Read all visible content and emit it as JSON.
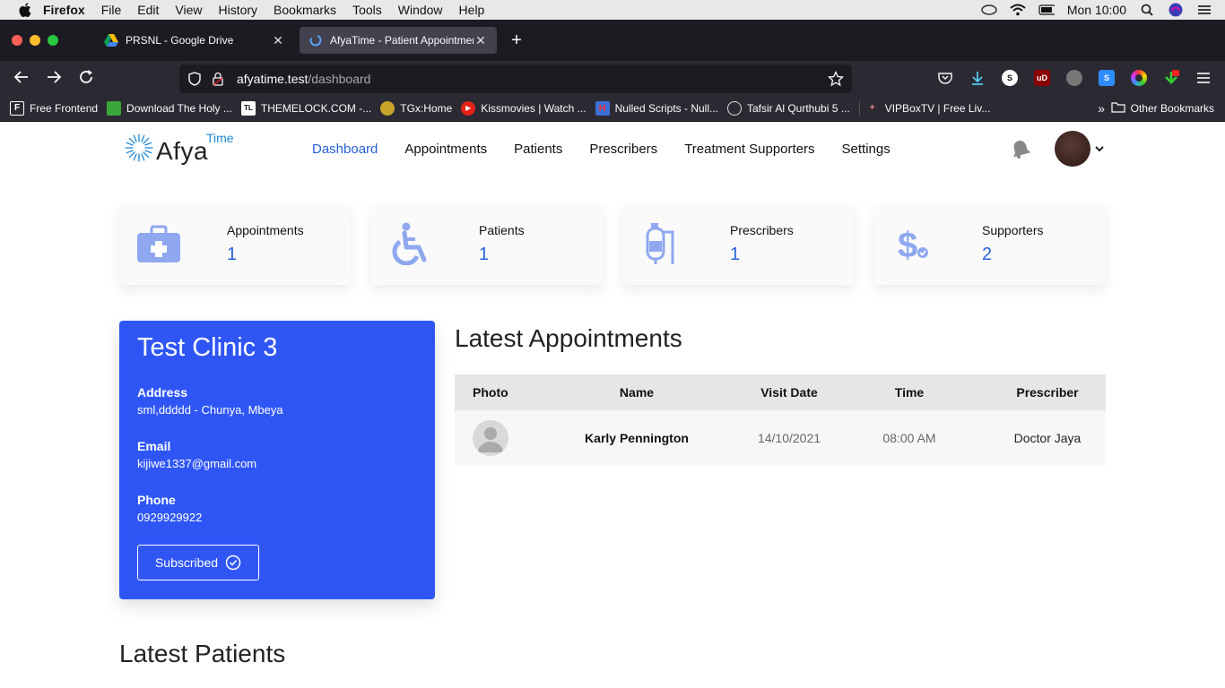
{
  "menubar": {
    "app_name": "Firefox",
    "items": [
      "File",
      "Edit",
      "View",
      "History",
      "Bookmarks",
      "Tools",
      "Window",
      "Help"
    ],
    "clock": "Mon 10:00"
  },
  "browser": {
    "tabs": [
      {
        "title": "PRSNL - Google Drive",
        "active": false
      },
      {
        "title": "AfyaTime - Patient Appointment",
        "active": true
      }
    ],
    "url_host": "afyatime.test",
    "url_path": "/dashboard",
    "bookmarks": [
      {
        "label": "Free Frontend",
        "icon_text": "F",
        "icon_color": "#ffffff"
      },
      {
        "label": "Download The Holy ...",
        "icon_text": "",
        "icon_color": "#3aa63a"
      },
      {
        "label": "THEMELOCK.COM -...",
        "icon_text": "TL",
        "icon_color": "#111111"
      },
      {
        "label": "TGx:Home",
        "icon_text": "",
        "icon_color": "#c9a52a"
      },
      {
        "label": "Kissmovies | Watch ...",
        "icon_text": "",
        "icon_color": "#e62117"
      },
      {
        "label": "Nulled Scripts - Null...",
        "icon_text": "",
        "icon_color": "#3b6fd8"
      },
      {
        "label": "Tafsir Al Qurthubi 5 ...",
        "icon_text": "",
        "icon_color": "#bbbbbb"
      },
      {
        "label": "VIPBoxTV | Free Liv...",
        "icon_text": "",
        "icon_color": "#c77"
      }
    ],
    "other_bookmarks": "Other Bookmarks"
  },
  "site": {
    "logo_main": "Afya",
    "logo_sup": "Time",
    "nav": [
      {
        "label": "Dashboard",
        "active": true
      },
      {
        "label": "Appointments",
        "active": false
      },
      {
        "label": "Patients",
        "active": false
      },
      {
        "label": "Prescribers",
        "active": false
      },
      {
        "label": "Treatment Supporters",
        "active": false
      },
      {
        "label": "Settings",
        "active": false
      }
    ],
    "accent_color": "#2962d9",
    "card_blue": "#2f56f5"
  },
  "stats": [
    {
      "label": "Appointments",
      "value": "1",
      "icon": "medical-kit-icon"
    },
    {
      "label": "Patients",
      "value": "1",
      "icon": "wheelchair-icon"
    },
    {
      "label": "Prescribers",
      "value": "1",
      "icon": "iv-bag-icon"
    },
    {
      "label": "Supporters",
      "value": "2",
      "icon": "dollar-check-icon"
    }
  ],
  "clinic": {
    "name": "Test Clinic 3",
    "address_label": "Address",
    "address": "sml,ddddd - Chunya, Mbeya",
    "email_label": "Email",
    "email": "kijiwe1337@gmail.com",
    "phone_label": "Phone",
    "phone": "0929929922",
    "subscribed_label": "Subscribed"
  },
  "appointments": {
    "title": "Latest Appointments",
    "columns": [
      "Photo",
      "Name",
      "Visit Date",
      "Time",
      "Prescriber"
    ],
    "rows": [
      {
        "name": "Karly Pennington",
        "visit_date": "14/10/2021",
        "time": "08:00 AM",
        "prescriber": "Doctor Jaya"
      }
    ]
  },
  "patients": {
    "title": "Latest Patients"
  }
}
